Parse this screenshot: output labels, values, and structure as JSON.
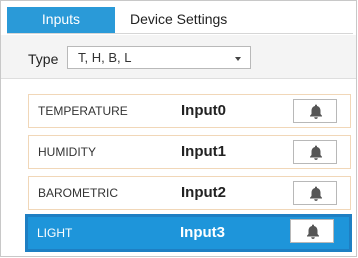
{
  "tabs": [
    {
      "label": "Inputs",
      "active": true
    },
    {
      "label": "Device Settings",
      "active": false
    }
  ],
  "type_filter": {
    "label": "Type",
    "value": "T, H, B, L"
  },
  "inputs": [
    {
      "sensor": "TEMPERATURE",
      "name": "Input0",
      "icon": "bell-icon",
      "selected": false
    },
    {
      "sensor": "HUMIDITY",
      "name": "Input1",
      "icon": "bell-icon",
      "selected": false
    },
    {
      "sensor": "BAROMETRIC",
      "name": "Input2",
      "icon": "bell-icon",
      "selected": false
    },
    {
      "sensor": "LIGHT",
      "name": "Input3",
      "icon": "bell-icon",
      "selected": true
    }
  ],
  "colors": {
    "accent": "#2a9ad8",
    "selected_row": "#1e95da",
    "row_border": "#f1d7b8"
  }
}
